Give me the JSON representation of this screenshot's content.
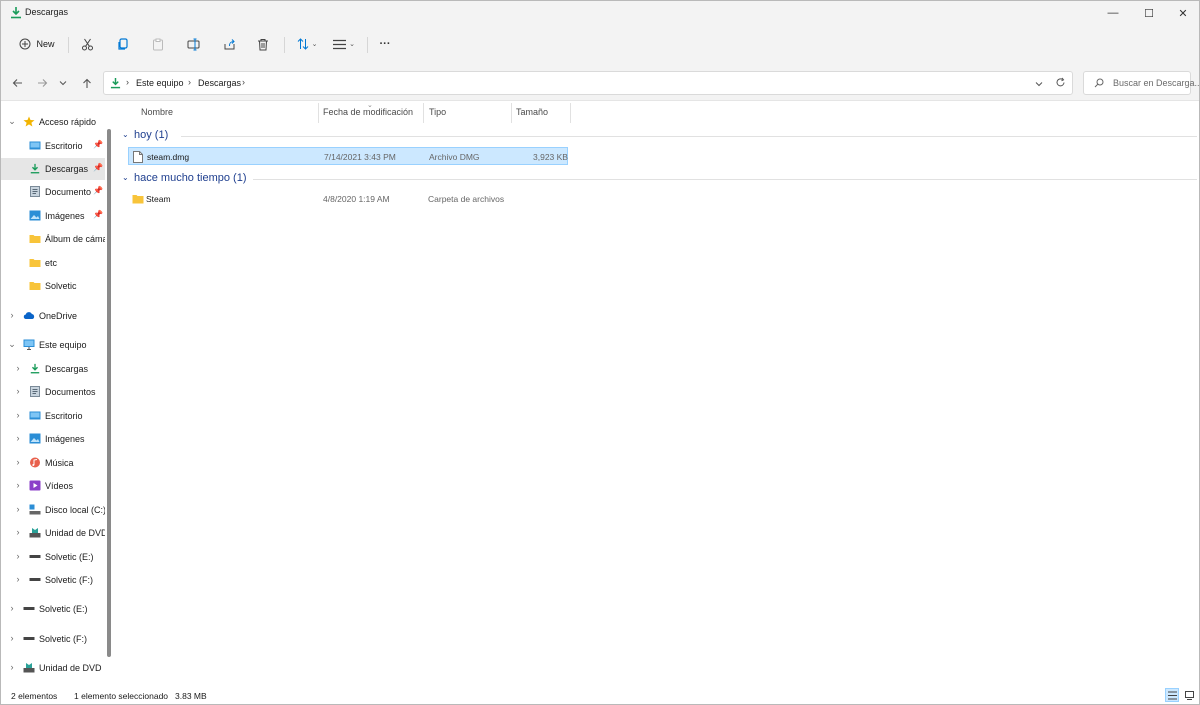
{
  "window": {
    "title": "Descargas",
    "minimize": "—",
    "maximize": "☐",
    "close": "✕"
  },
  "toolbar": {
    "new_label": "New",
    "more": "···"
  },
  "address": {
    "crumbs": [
      "Este equipo",
      "Descargas"
    ]
  },
  "search": {
    "placeholder": "Buscar en Descarga..."
  },
  "sidebar": {
    "quick_access": "Acceso rápido",
    "quick_items": [
      "Escritorio",
      "Descargas",
      "Documento",
      "Imágenes",
      "Álbum de cáma",
      "etc",
      "Solvetic"
    ],
    "onedrive": "OneDrive",
    "this_pc": "Este equipo",
    "pc_items": [
      "Descargas",
      "Documentos",
      "Escritorio",
      "Imágenes",
      "Música",
      "Vídeos",
      "Disco local (C:)",
      "Unidad de DVD",
      "Solvetic (E:)",
      "Solvetic (F:)"
    ],
    "drives": [
      "Solvetic (E:)",
      "Solvetic (F:)",
      "Unidad de DVD ("
    ]
  },
  "columns": {
    "name": "Nombre",
    "date": "Fecha de modificación",
    "type": "Tipo",
    "size": "Tamaño"
  },
  "groups": [
    {
      "label": "hoy (1)",
      "files": [
        {
          "name": "steam.dmg",
          "date": "7/14/2021 3:43 PM",
          "type": "Archivo DMG",
          "size": "3,923 KB"
        }
      ]
    },
    {
      "label": "hace mucho tiempo (1)",
      "files": [
        {
          "name": "Steam",
          "date": "4/8/2020 1:19 AM",
          "type": "Carpeta de archivos",
          "size": ""
        }
      ]
    }
  ],
  "status": {
    "count": "2 elementos",
    "selection": "1 elemento seleccionado",
    "size": "3.83 MB"
  },
  "colors": {
    "accent": "#0078d4",
    "selection": "#cce8ff",
    "group_text": "#1f3f8f",
    "folder": "#f8c43a",
    "download": "#1a9c5a"
  }
}
